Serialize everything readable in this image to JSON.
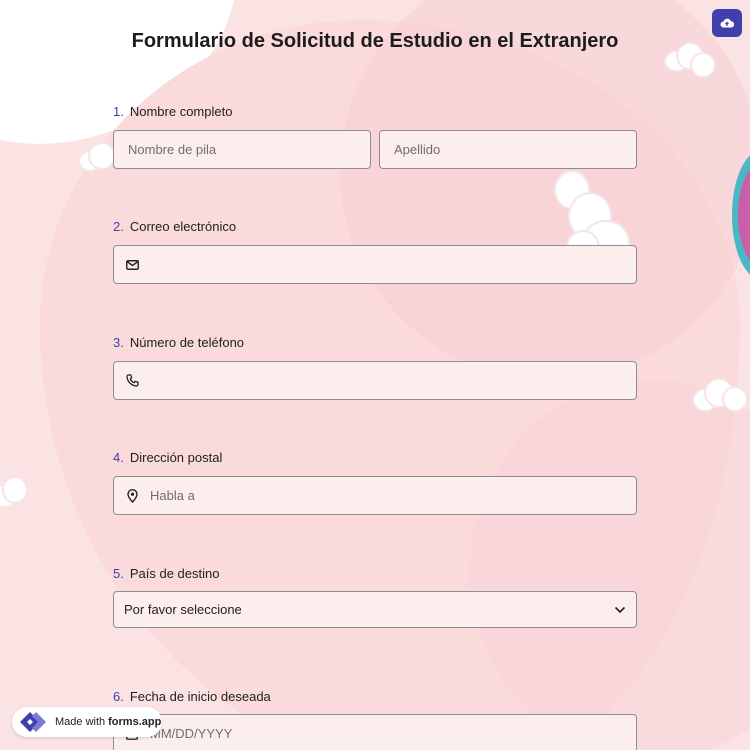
{
  "form": {
    "title": "Formulario de Solicitud de Estudio en el Extranjero",
    "questions": [
      {
        "number": "1.",
        "label": "Nombre completo",
        "first_placeholder": "Nombre de pila",
        "last_placeholder": "Apellido"
      },
      {
        "number": "2.",
        "label": "Correo electrónico",
        "icon": "mail-icon"
      },
      {
        "number": "3.",
        "label": "Número de teléfono",
        "icon": "phone-icon"
      },
      {
        "number": "4.",
        "label": "Dirección postal",
        "icon": "map-pin-icon",
        "placeholder": "Habla a"
      },
      {
        "number": "5.",
        "label": "País de destino",
        "selected": "Por favor seleccione",
        "icon": "chevron-down-icon"
      },
      {
        "number": "6.",
        "label": "Fecha de inicio deseada",
        "icon": "calendar-icon",
        "placeholder": "MM/DD/YYYY"
      }
    ]
  },
  "badge": {
    "prefix": "Made with",
    "brand": "forms.app",
    "icon": "forms-app-logo-icon"
  },
  "toolbar": {
    "upload_icon": "cloud-upload-icon"
  },
  "colors": {
    "accent": "#3f3fae",
    "background": "#fbe3e3",
    "field_bg": "#fdeeee"
  }
}
